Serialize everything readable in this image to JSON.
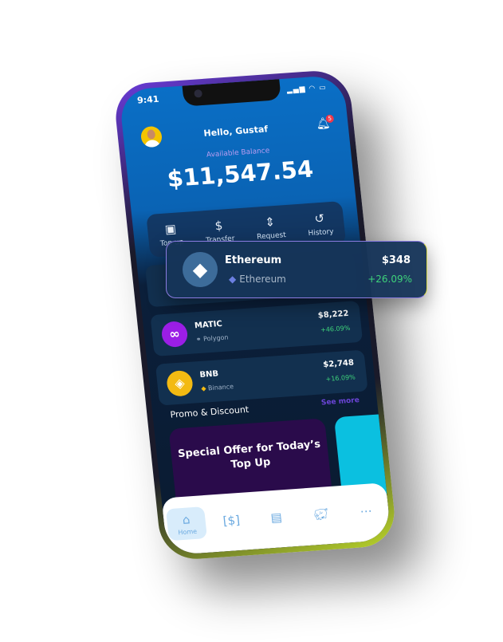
{
  "status_bar": {
    "time": "9:41",
    "icons": "signal-wifi-battery"
  },
  "header": {
    "greeting": "Hello, Gustaf",
    "notification_count": "5",
    "balance_label": "Available Balance",
    "balance": "$11,547.54"
  },
  "actions": [
    {
      "label": "Top up",
      "icon": "wallet-icon"
    },
    {
      "label": "Transfer",
      "icon": "hand-dollar-icon"
    },
    {
      "label": "Request",
      "icon": "money-request-icon"
    },
    {
      "label": "History",
      "icon": "history-icon"
    }
  ],
  "featured_coin": {
    "name": "Ethereum",
    "network": "Ethereum",
    "price": "$348",
    "change": "+26.09%"
  },
  "coins": [
    {
      "name": "MATIC",
      "network": "Polygon",
      "price": "$8,222",
      "change": "+46.09%",
      "color": "#9b1ee6"
    },
    {
      "name": "BNB",
      "network": "Binance",
      "price": "$2,748",
      "change": "+16.09%",
      "color": "#f3ba12"
    }
  ],
  "promo": {
    "title": "Promo & Discount",
    "see_more": "See more",
    "card_text": "Special Offer for Today’s Top Up"
  },
  "bottom_nav": [
    {
      "label": "Home",
      "icon": "home-icon",
      "active": true
    },
    {
      "icon": "cash-icon"
    },
    {
      "icon": "archive-icon"
    },
    {
      "icon": "piggy-bank-icon"
    },
    {
      "icon": "more-icon"
    }
  ],
  "colors": {
    "accent": "#0a6fc6",
    "positive": "#3ed27a",
    "see_more": "#6b45d8"
  }
}
